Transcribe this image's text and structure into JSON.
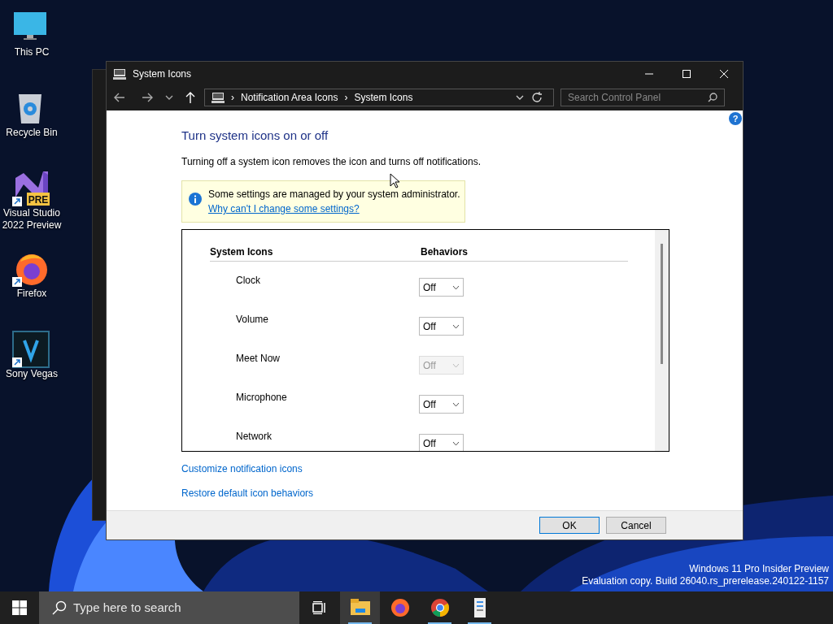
{
  "desktop_icons": [
    {
      "label": "This PC",
      "kind": "monitor",
      "shortcut": false
    },
    {
      "label": "Recycle Bin",
      "kind": "bin",
      "shortcut": false
    },
    {
      "label": "Visual Studio 2022 Preview",
      "kind": "vs",
      "shortcut": true,
      "badge": "PRE"
    },
    {
      "label": "Firefox",
      "kind": "firefox",
      "shortcut": true
    },
    {
      "label": "Sony Vegas",
      "kind": "vegas",
      "shortcut": true
    }
  ],
  "window": {
    "title": "System Icons",
    "help_button": "?",
    "address": {
      "separator": "›",
      "crumbs": [
        "Notification Area Icons",
        "System Icons"
      ]
    },
    "search": {
      "placeholder": "Search Control Panel"
    },
    "heading": "Turn system icons on or off",
    "description": "Turning off a system icon removes the icon and turns off notifications.",
    "notice": {
      "text": "Some settings are managed by your system administrator.",
      "link": "Why can't I change some settings?"
    },
    "table": {
      "columns": [
        "System Icons",
        "Behaviors"
      ],
      "rows": [
        {
          "name": "Clock",
          "behavior": "Off",
          "disabled": false
        },
        {
          "name": "Volume",
          "behavior": "Off",
          "disabled": false
        },
        {
          "name": "Meet Now",
          "behavior": "Off",
          "disabled": true
        },
        {
          "name": "Microphone",
          "behavior": "Off",
          "disabled": false
        },
        {
          "name": "Network",
          "behavior": "Off",
          "disabled": false
        }
      ]
    },
    "links": [
      "Customize notification icons",
      "Restore default icon behaviors"
    ],
    "buttons": [
      {
        "label": "OK",
        "default": true
      },
      {
        "label": "Cancel",
        "default": false
      }
    ]
  },
  "watermark": {
    "lines": [
      "Windows 11 Pro Insider Preview",
      "Evaluation copy. Build 26040.rs_prerelease.240122-1157"
    ]
  },
  "taskbar": {
    "search": {
      "placeholder": "Type here to search"
    },
    "apps": [
      {
        "kind": "explorer",
        "running": true,
        "active": true
      },
      {
        "kind": "firefox",
        "running": false,
        "active": false
      },
      {
        "kind": "chrome",
        "running": true,
        "active": false
      },
      {
        "kind": "controlpanel",
        "running": true,
        "active": false
      }
    ]
  }
}
